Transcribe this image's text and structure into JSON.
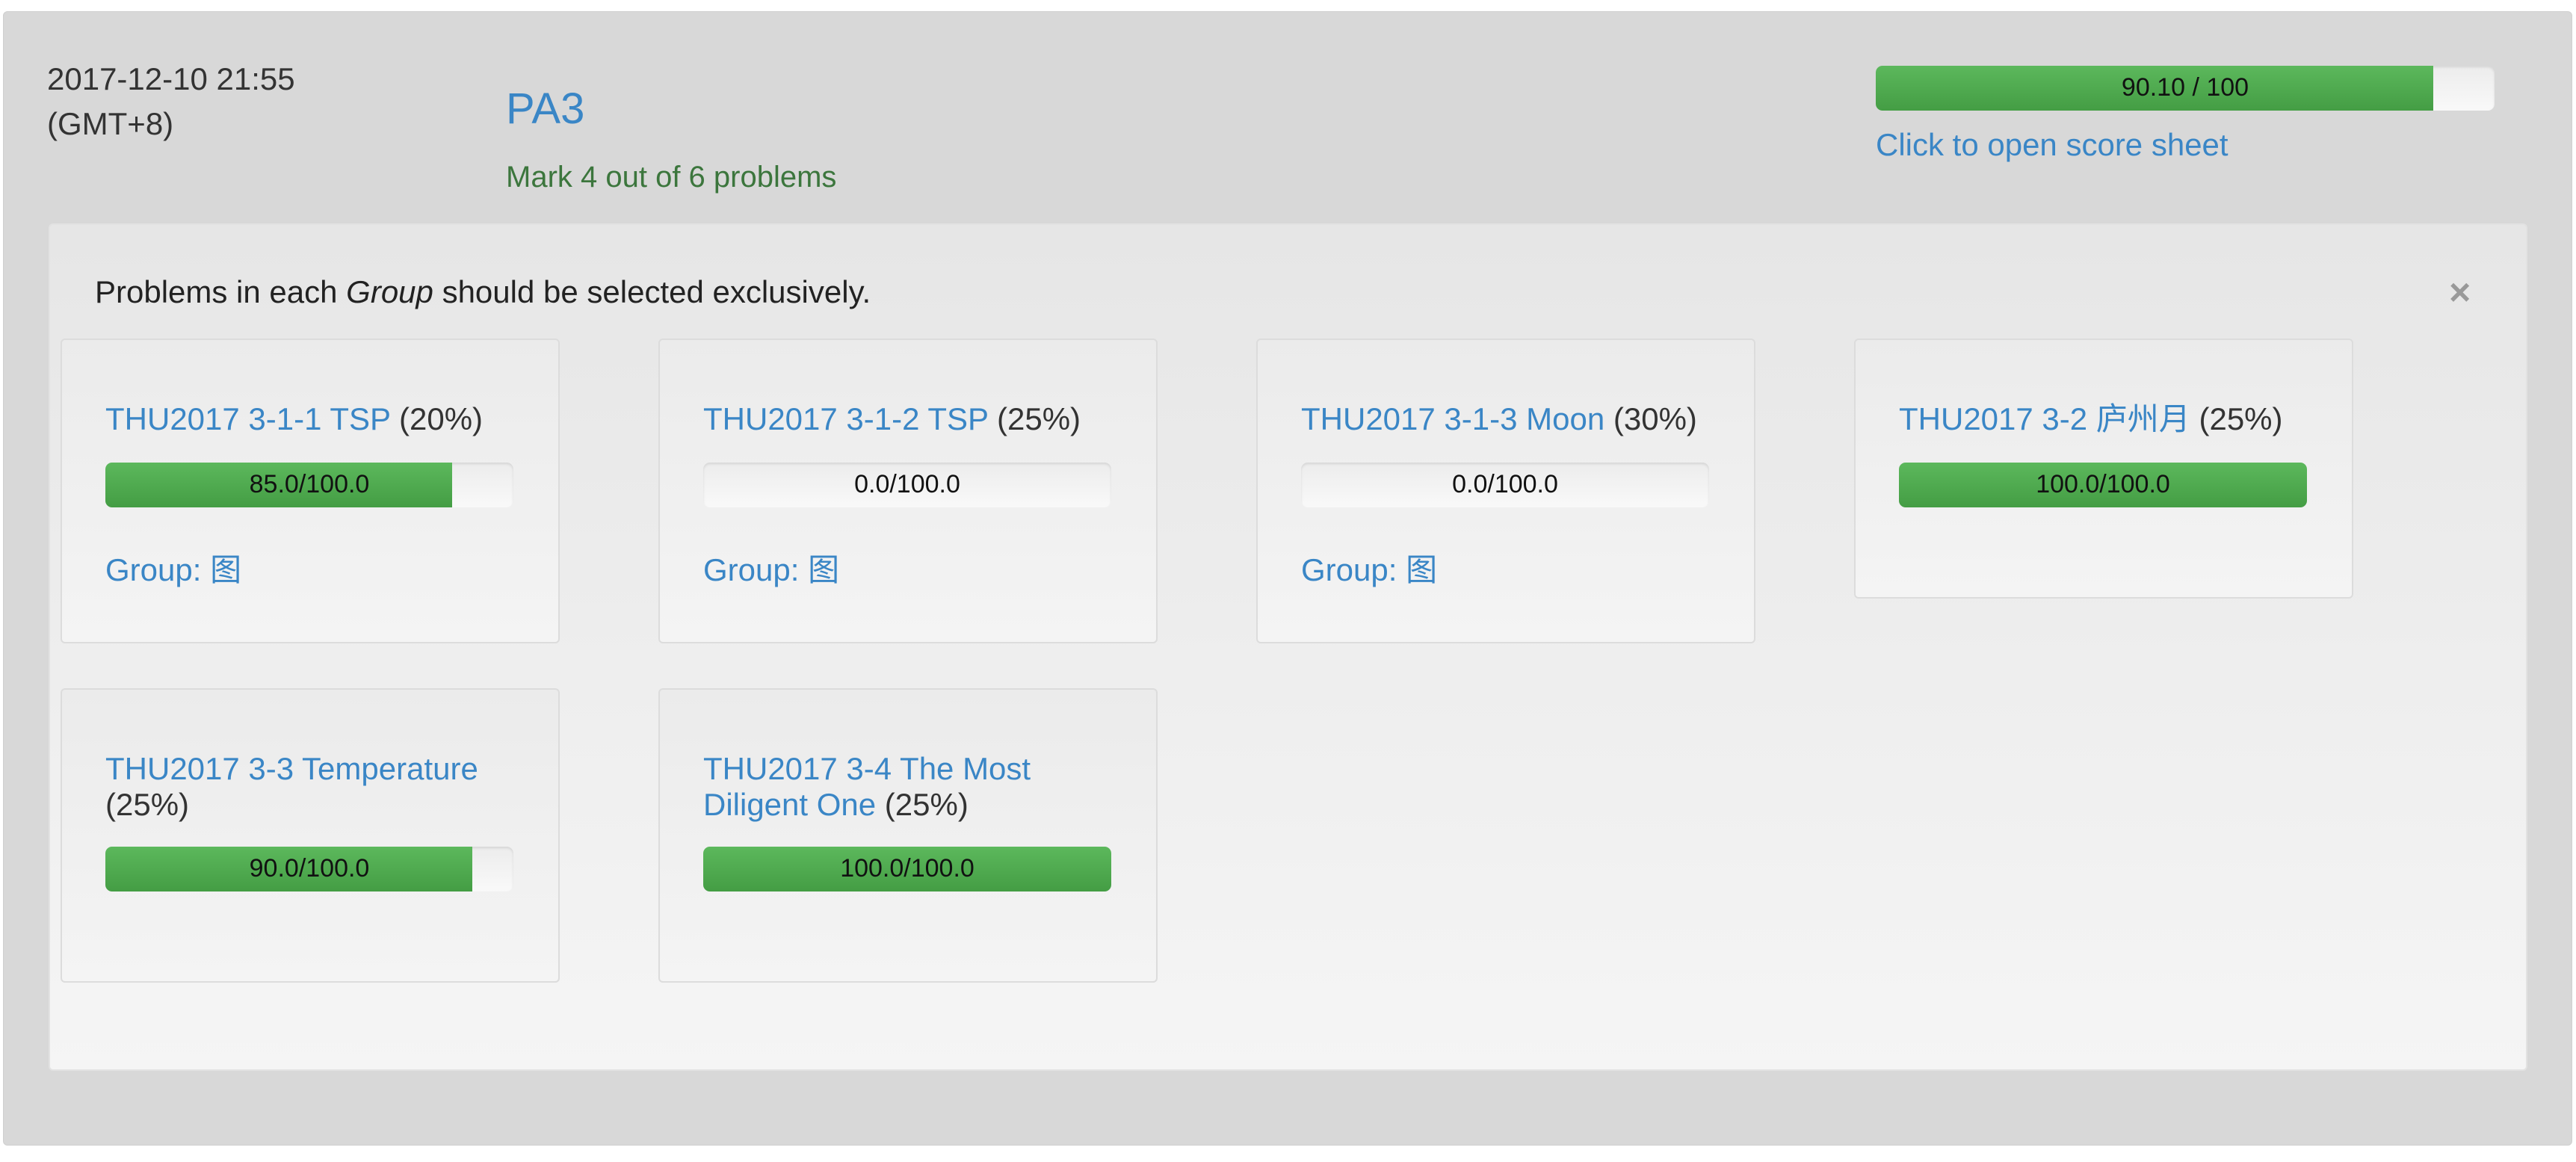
{
  "header": {
    "time_line1": "2017-12-10 21:55",
    "time_line2": "(GMT+8)",
    "title": "PA3",
    "mark_text": "Mark 4 out of 6 problems",
    "total_score_text": "90.10 / 100",
    "total_score_fraction": 0.901,
    "open_sheet_text": "Click to open score sheet"
  },
  "panel": {
    "info_before": "Problems in each ",
    "info_em": "Group",
    "info_after": " should be selected exclusively.",
    "close_symbol": "×",
    "close_icon": "close-icon"
  },
  "problems": [
    {
      "name": "THU2017 3-1-1 TSP",
      "percent": "(20%)",
      "score_text": "85.0/100.0",
      "fraction": 0.85,
      "group": "Group: 图"
    },
    {
      "name": "THU2017 3-1-2 TSP",
      "percent": "(25%)",
      "score_text": "0.0/100.0",
      "fraction": 0.0,
      "group": "Group: 图"
    },
    {
      "name": "THU2017 3-1-3 Moon",
      "percent": "(30%)",
      "score_text": "0.0/100.0",
      "fraction": 0.0,
      "group": "Group: 图"
    },
    {
      "name": "THU2017 3-2 庐州月",
      "percent": "(25%)",
      "score_text": "100.0/100.0",
      "fraction": 1.0
    },
    {
      "name": "THU2017 3-3 Temperature",
      "percent": "(25%)",
      "score_text": "90.0/100.0",
      "fraction": 0.9
    },
    {
      "name": "THU2017 3-4 The Most Diligent One",
      "percent": "(25%)",
      "score_text": "100.0/100.0",
      "fraction": 1.0
    }
  ],
  "colors": {
    "link": "#3a86c6",
    "success_bar": "#5cb85c",
    "mark_text": "#3c763d"
  }
}
